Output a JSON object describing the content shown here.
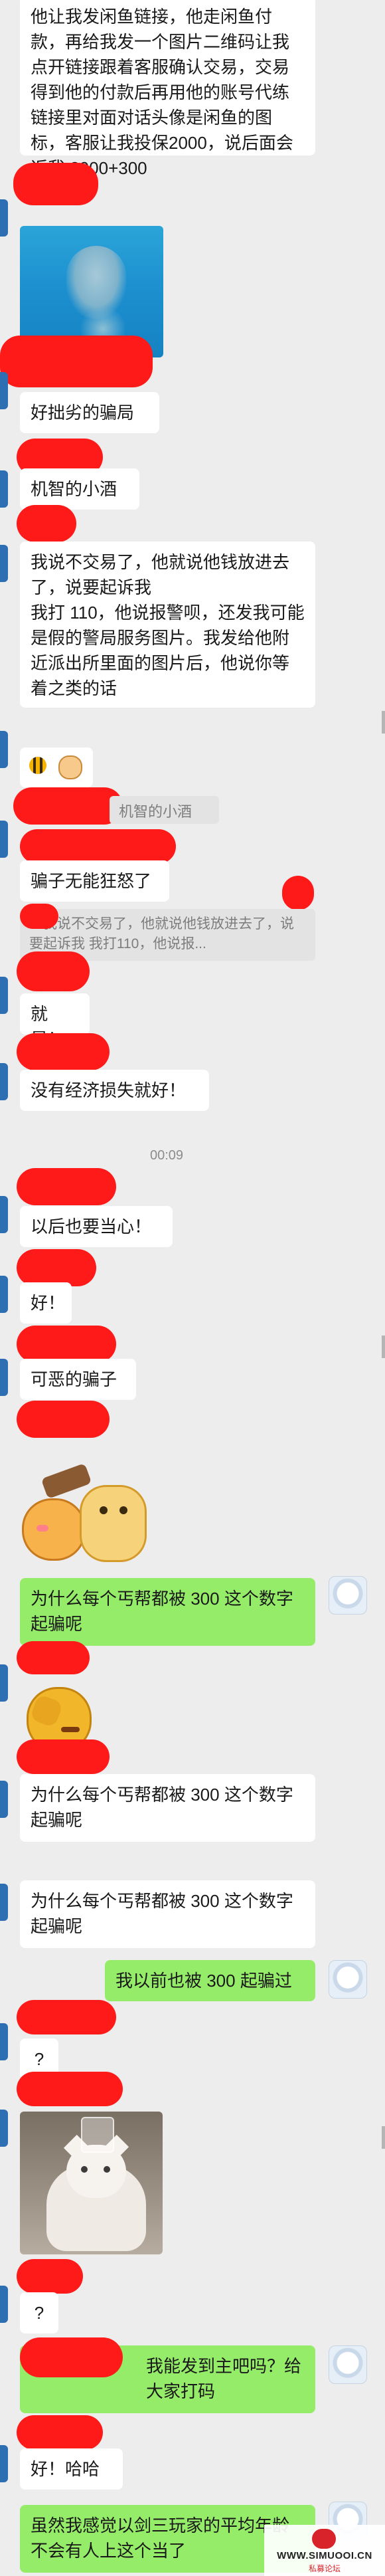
{
  "messages": {
    "m1": "他让我发闲鱼链接，他走闲鱼付款，再给我发一个图片二维码让我点开链接跟着客服确认交易，交易得到他的付款后再用他的账号代练链接里对面对话头像是闲鱼的图标，客服让我投保2000，说后面会返我 2000+300",
    "m2": "好拙劣的骗局",
    "m3": "机智的小酒",
    "m4": "我说不交易了，他就说他钱放进去了，说要起诉我\n我打 110，他说报警呗，还发我可能是假的警局服务图片。我发给他附近派出所里面的图片后，他说你等着之类的话",
    "m5_quote_name": "机智的小酒",
    "m6": "骗子无能狂怒了",
    "m6_quote": "：我说不交易了，他就说他钱放进去了，说要起诉我 我打110，他说报...",
    "m7": "就是！",
    "m8": "没有经济损失就好！",
    "time1": "00:09",
    "m9": "以后也要当心！",
    "m10": "好！",
    "m11": "可恶的骗子",
    "m12": "为什么每个丐帮都被 300 这个数字起骗呢",
    "m13": "为什么每个丐帮都被 300 这个数字起骗呢",
    "m14": "为什么每个丐帮都被 300 这个数字起骗呢",
    "m15": "我以前也被 300 起骗过",
    "m16": "?",
    "m17": "?",
    "m18": "我能发到主吧吗？给大家打码",
    "m19": "好！哈哈",
    "m20": "虽然我感觉以剑三玩家的平均年龄不会有人上这个当了"
  },
  "watermark": {
    "line1": "WWW.SIMUOOI.CN",
    "line2": "私募论坛"
  },
  "colors": {
    "background": "#ededed",
    "bubble_white": "#ffffff",
    "bubble_green": "#95ec69",
    "redaction": "#ff1a1a"
  }
}
